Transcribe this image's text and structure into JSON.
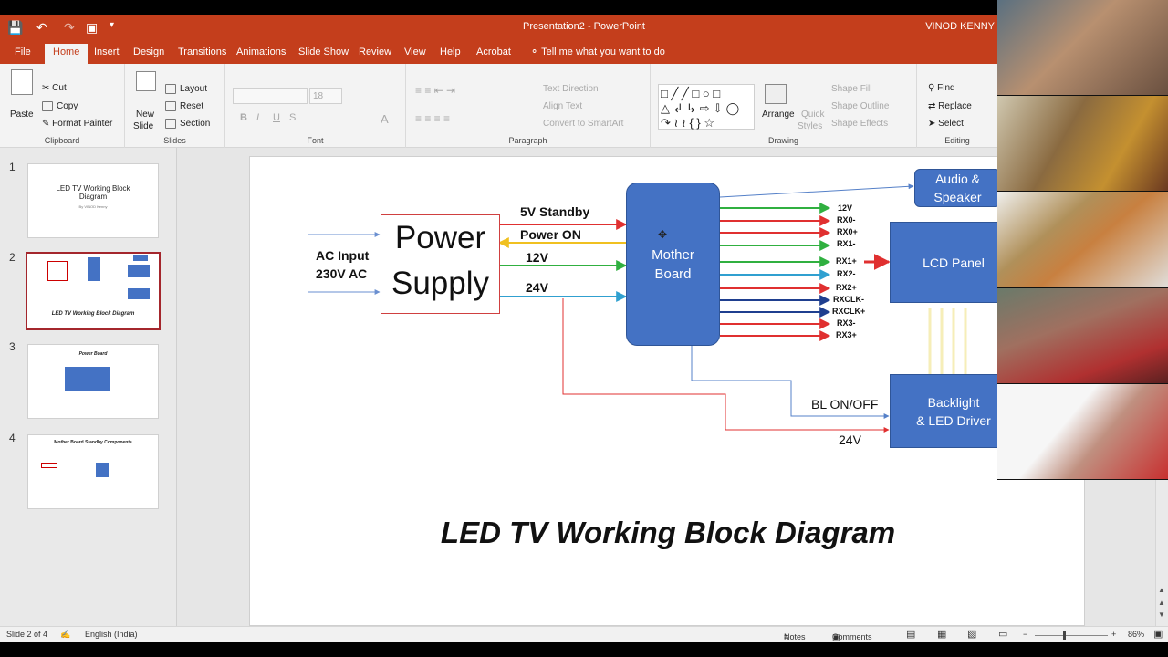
{
  "app": {
    "title": "Presentation2 - PowerPoint",
    "user": "VINOD KENNY"
  },
  "tabs": [
    "File",
    "Home",
    "Insert",
    "Design",
    "Transitions",
    "Animations",
    "Slide Show",
    "Review",
    "View",
    "Help",
    "Acrobat"
  ],
  "tell_me": "Tell me what you want to do",
  "ribbon": {
    "clipboard": {
      "paste": "Paste",
      "cut": "Cut",
      "copy": "Copy",
      "format_painter": "Format Painter",
      "label": "Clipboard"
    },
    "slides": {
      "new_slide_1": "New",
      "new_slide_2": "Slide",
      "layout": "Layout",
      "reset": "Reset",
      "section": "Section",
      "label": "Slides"
    },
    "font": {
      "size": "18",
      "label": "Font"
    },
    "paragraph": {
      "text_direction": "Text Direction",
      "align_text": "Align Text",
      "smartart": "Convert to SmartArt",
      "label": "Paragraph"
    },
    "drawing": {
      "arrange": "Arrange",
      "quick_styles_1": "Quick",
      "quick_styles_2": "Styles",
      "shape_fill": "Shape Fill",
      "shape_outline": "Shape Outline",
      "shape_effects": "Shape Effects",
      "label": "Drawing"
    },
    "editing": {
      "find": "Find",
      "replace": "Replace",
      "select": "Select",
      "label": "Editing"
    }
  },
  "thumbnails": [
    {
      "num": "1",
      "title": "LED TV Working Block Diagram",
      "sub": "By VINOD Kenny"
    },
    {
      "num": "2",
      "title": "LED TV Working Block Diagram"
    },
    {
      "num": "3",
      "title": "Power Board"
    },
    {
      "num": "4",
      "title": "Mother Board Standby Components"
    }
  ],
  "slide": {
    "power_supply_1": "Power",
    "power_supply_2": "Supply",
    "ac_input_1": "AC Input",
    "ac_input_2": "230V AC",
    "standby": "5V Standby",
    "power_on": "Power ON",
    "v12": "12V",
    "v24": "24V",
    "mother_board_1": "Mother",
    "mother_board_2": "Board",
    "audio_1": "Audio &",
    "audio_2": "Speaker",
    "lcd": "LCD Panel",
    "backlight_1": "Backlight",
    "backlight_2": "& LED Driver",
    "bl_onoff": "BL ON/OFF",
    "v24_bottom": "24V",
    "signals": [
      "12V",
      "RX0-",
      "RX0+",
      "RX1-",
      "RX1+",
      "RX2-",
      "RX2+",
      "RXCLK-",
      "RXCLK+",
      "RX3-",
      "RX3+"
    ],
    "caption": "LED TV Working Block Diagram"
  },
  "status": {
    "slide_info": "Slide 2 of 4",
    "language": "English (India)",
    "notes": "Notes",
    "comments": "Comments",
    "zoom": "86%"
  },
  "colors": {
    "brand": "#c43e1c",
    "box_blue": "#4472c4"
  }
}
